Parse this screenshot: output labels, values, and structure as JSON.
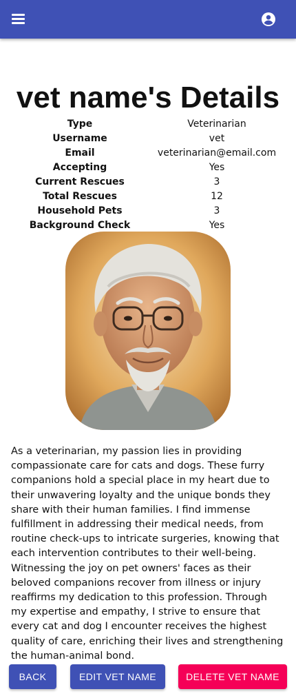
{
  "colors": {
    "primary": "#3f51b5",
    "accent": "#f50057"
  },
  "appbar": {
    "menu_icon": "menu-icon",
    "account_icon": "account-circle-icon"
  },
  "page": {
    "title": "vet name's Details"
  },
  "details": [
    {
      "label": "Type",
      "value": "Veterinarian"
    },
    {
      "label": "Username",
      "value": "vet"
    },
    {
      "label": "Email",
      "value": "veterinarian@email.com"
    },
    {
      "label": "Accepting",
      "value": "Yes"
    },
    {
      "label": "Current Rescues",
      "value": "3"
    },
    {
      "label": "Total Rescues",
      "value": "12"
    },
    {
      "label": "Household Pets",
      "value": "3"
    },
    {
      "label": "Background Check",
      "value": "Yes"
    }
  ],
  "bio": "As a veterinarian, my passion lies in providing compassionate care for cats and dogs. These furry companions hold a special place in my heart due to their unwavering loyalty and the unique bonds they share with their human families. I find immense fulfillment in addressing their medical needs, from routine check-ups to intricate surgeries, knowing that each intervention contributes to their well-being. Witnessing the joy on pet owners' faces as their beloved companions recover from illness or injury reaffirms my dedication to this profession. Through my expertise and empathy, I strive to ensure that every cat and dog I encounter receives the highest quality of care, enriching their lives and strengthening the human-animal bond.",
  "actions": {
    "back": "BACK",
    "edit": "EDIT VET NAME",
    "delete": "DELETE VET NAME"
  }
}
